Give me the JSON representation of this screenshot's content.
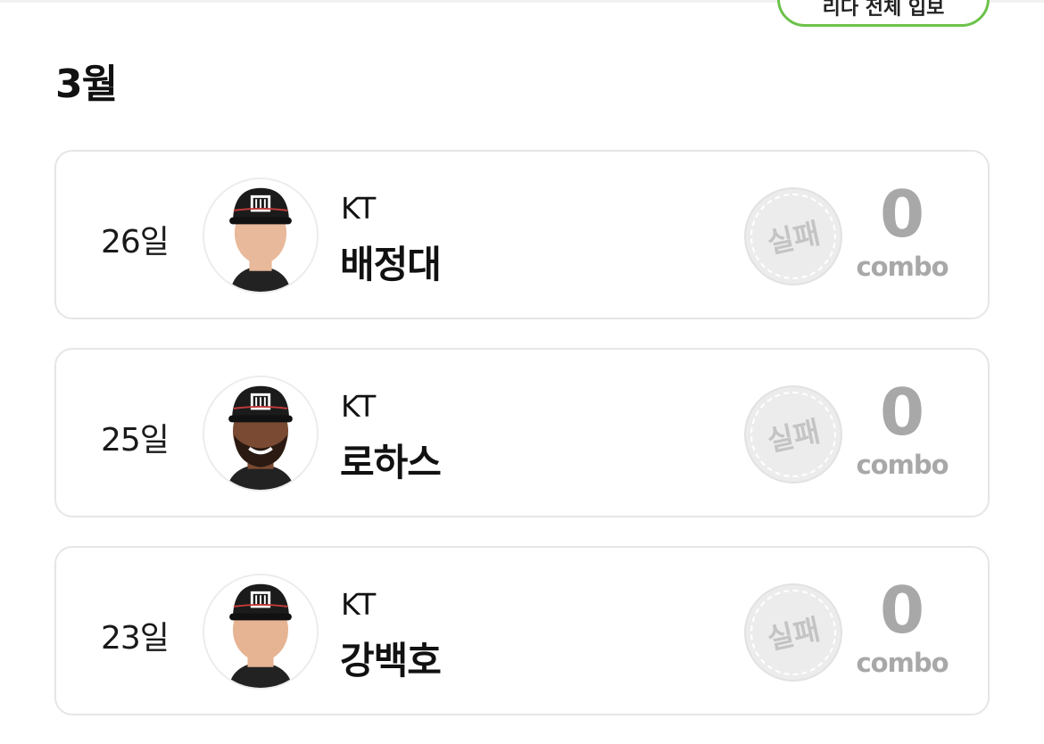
{
  "header": {
    "top_button_label": "리다 전체 입보"
  },
  "month_title": "3월",
  "entries": [
    {
      "date": "26일",
      "team": "KT",
      "player": "배정대",
      "result": "실패",
      "combo_value": "0",
      "combo_label": "combo",
      "skin": "#e8b99a",
      "beard": false
    },
    {
      "date": "25일",
      "team": "KT",
      "player": "로하스",
      "result": "실패",
      "combo_value": "0",
      "combo_label": "combo",
      "skin": "#7a4a32",
      "beard": true
    },
    {
      "date": "23일",
      "team": "KT",
      "player": "강백호",
      "result": "실패",
      "combo_value": "0",
      "combo_label": "combo",
      "skin": "#e6b493",
      "beard": false
    }
  ],
  "colors": {
    "accent_green": "#6cc24a",
    "cap": "#1b1b1b",
    "muted": "#a8a8a8"
  }
}
